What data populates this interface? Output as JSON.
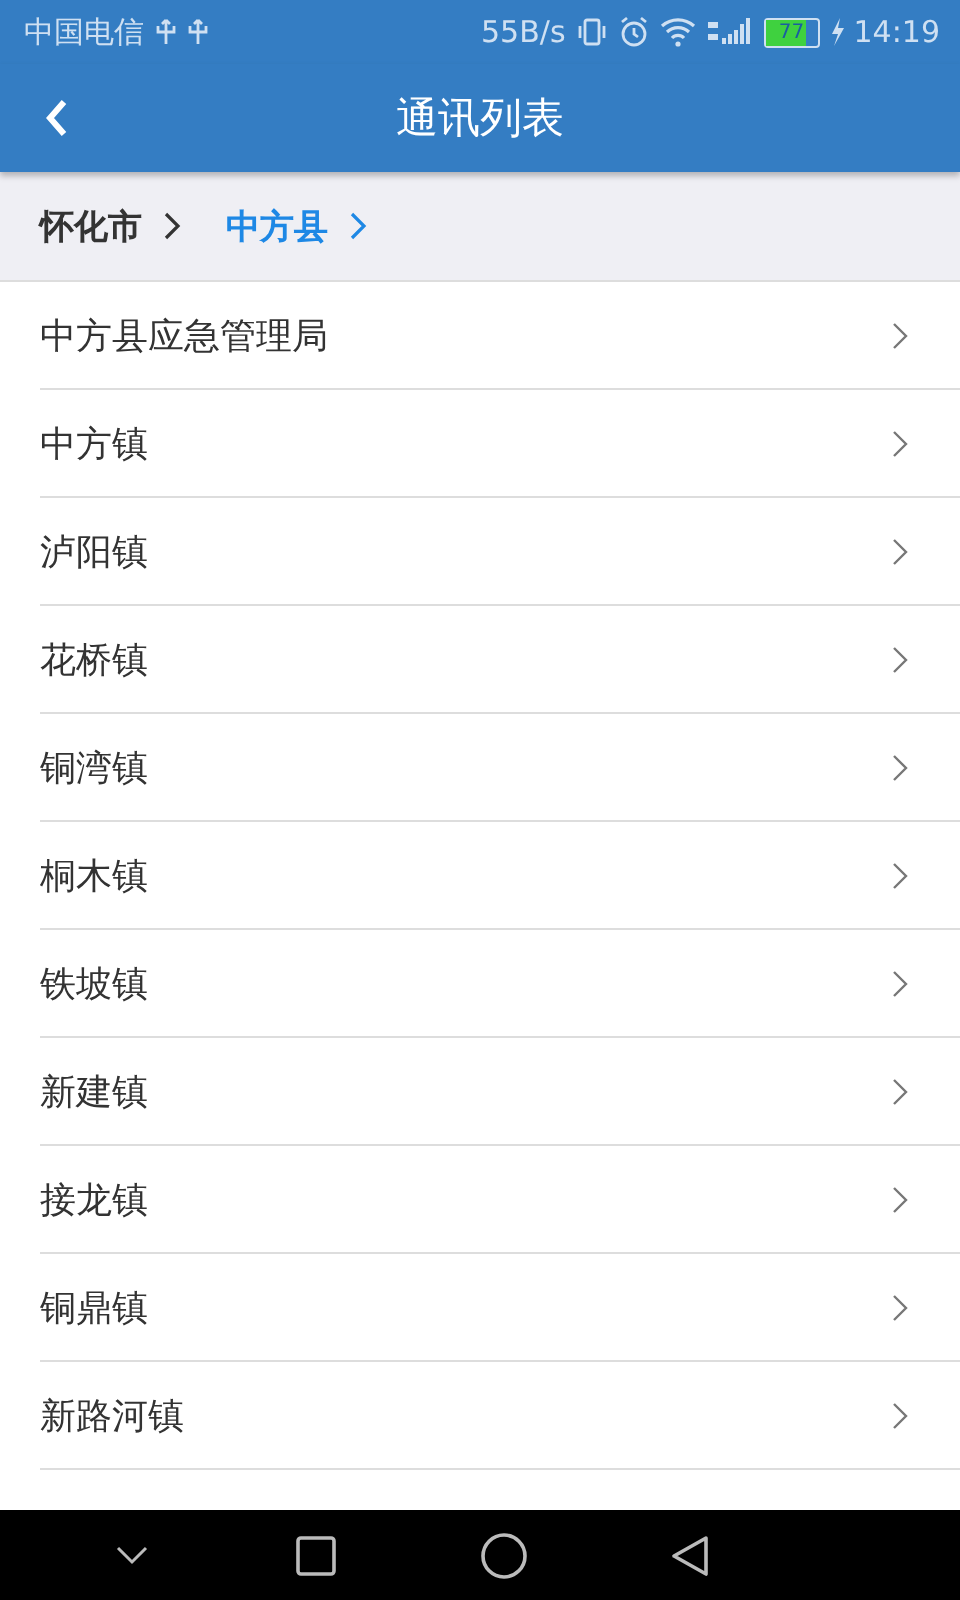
{
  "status_bar": {
    "carrier": "中国电信",
    "speed": "55B/s",
    "battery": {
      "text": "77",
      "level": 0.77
    },
    "time": "14:19"
  },
  "app_bar": {
    "title": "通讯列表"
  },
  "breadcrumb": [
    {
      "label": "怀化市",
      "selected": false
    },
    {
      "label": "中方县",
      "selected": true
    }
  ],
  "list": [
    {
      "label": "中方县应急管理局"
    },
    {
      "label": "中方镇"
    },
    {
      "label": "泸阳镇"
    },
    {
      "label": "花桥镇"
    },
    {
      "label": "铜湾镇"
    },
    {
      "label": "桐木镇"
    },
    {
      "label": "铁坡镇"
    },
    {
      "label": "新建镇"
    },
    {
      "label": "接龙镇"
    },
    {
      "label": "铜鼎镇"
    },
    {
      "label": "新路河镇"
    }
  ]
}
